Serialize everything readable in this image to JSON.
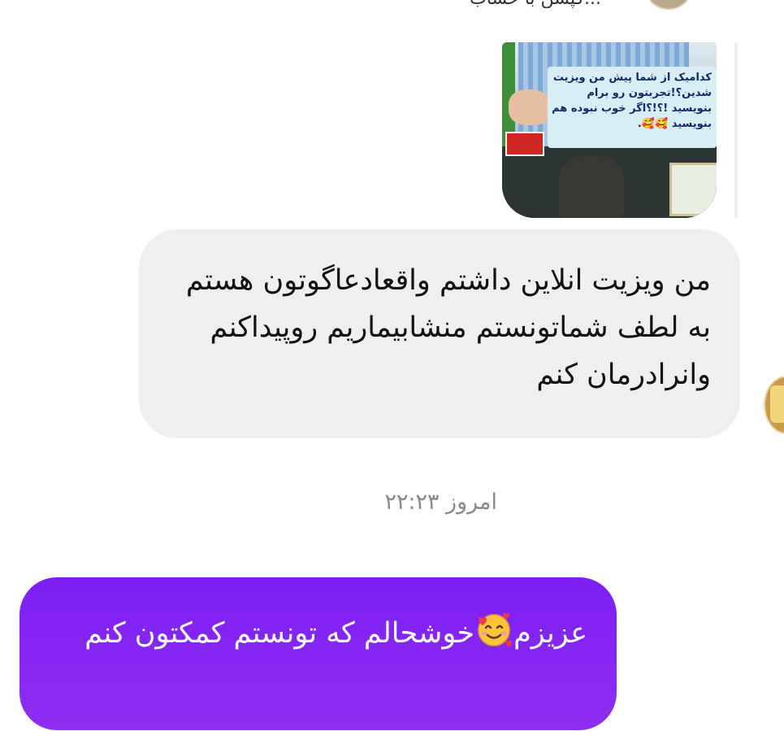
{
  "previous_message": {
    "partial_text": "...کپشن با حساب"
  },
  "shared_post": {
    "card_text": "کدامیک از شما پیش من ویزیت شدین؟!تجربتون رو برام بنویسید !؟!؟اگر خوب نبوده هم بنویسید 🥰🥰."
  },
  "incoming_message": {
    "text": "من ویزیت انلاین داشتم واقعادعاگوتون هستم به لطف شماتونستم منشابیماریم روپیداکنم وانرادرمان کنم"
  },
  "timestamp": {
    "text": "امروز ۲۲:۲۳"
  },
  "outgoing_message": {
    "text_before_emoji": "عزیزم",
    "emoji_icon": "smiling-face-with-hearts-icon",
    "text_after_emoji": "خوشحالم که تونستم کمکتون کنم"
  },
  "colors": {
    "outgoing_bubble": "#8328f3",
    "incoming_bubble": "#efefef",
    "timestamp_text": "#8a8a8a"
  }
}
